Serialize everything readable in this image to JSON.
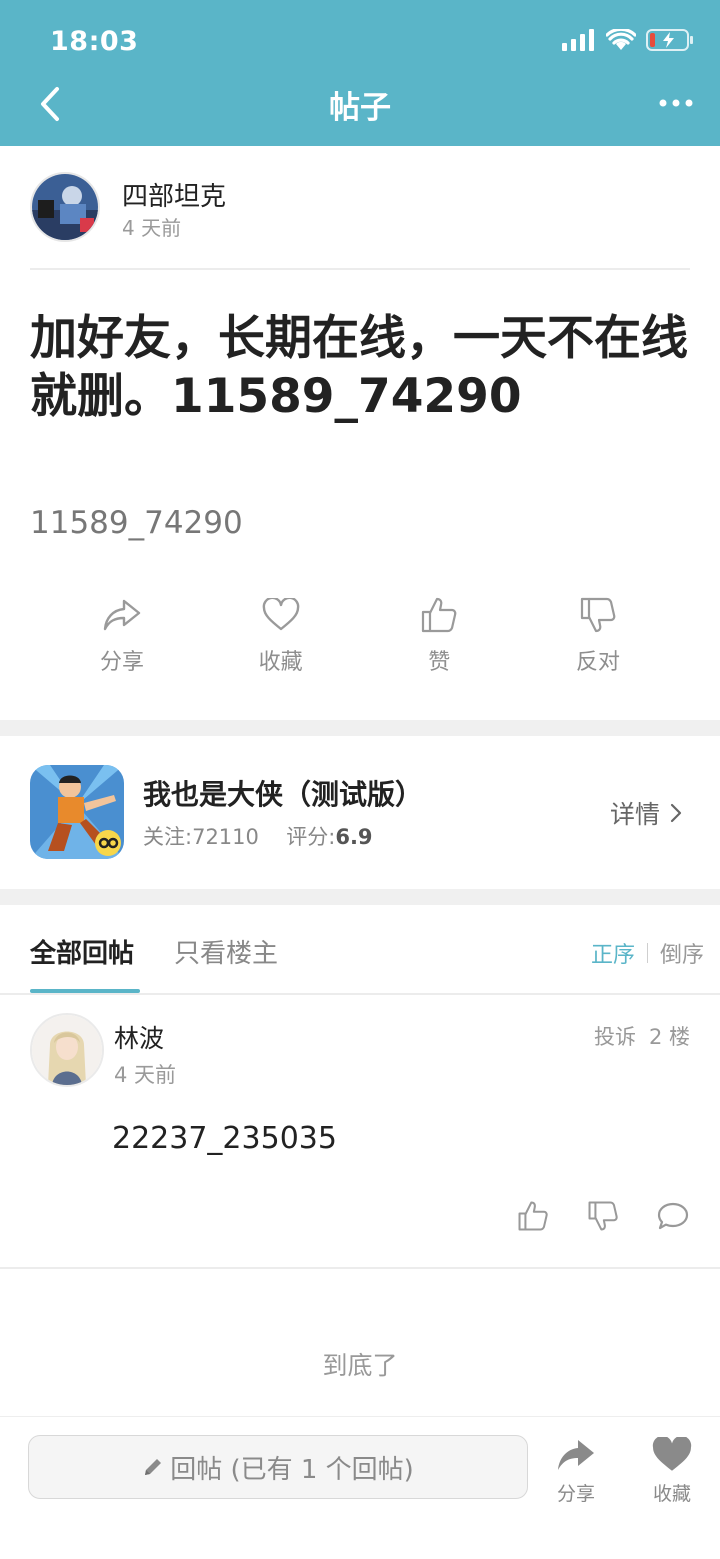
{
  "status_bar": {
    "time": "18:03"
  },
  "nav": {
    "title": "帖子"
  },
  "author": {
    "name": "四部坦克",
    "time": "4 天前"
  },
  "post": {
    "title": "加好友，长期在线，一天不在线就删。11589_74290",
    "body": "11589_74290"
  },
  "actions": [
    {
      "label": "分享",
      "icon": "share-icon"
    },
    {
      "label": "收藏",
      "icon": "heart-icon"
    },
    {
      "label": "赞",
      "icon": "thumbs-up-icon"
    },
    {
      "label": "反对",
      "icon": "thumbs-down-icon"
    }
  ],
  "game": {
    "name": "我也是大侠（测试版）",
    "follow_label": "关注:",
    "follow_count": "72110",
    "score_label": "评分:",
    "score": "6.9",
    "detail_label": "详情"
  },
  "tabs": {
    "all": "全部回帖",
    "owner_only": "只看楼主"
  },
  "sort": {
    "asc": "正序",
    "desc": "倒序"
  },
  "reply": {
    "name": "林波",
    "time": "4 天前",
    "report": "投诉",
    "floor": "2 楼",
    "content": "22237_235035"
  },
  "end_text": "到底了",
  "bottom_bar": {
    "reply_placeholder": "回帖 (已有 1 个回帖)",
    "share_label": "分享",
    "favorite_label": "收藏"
  },
  "colors": {
    "accent": "#5ab5c8",
    "header_bg": "#5ab5c8",
    "muted": "#999999"
  }
}
